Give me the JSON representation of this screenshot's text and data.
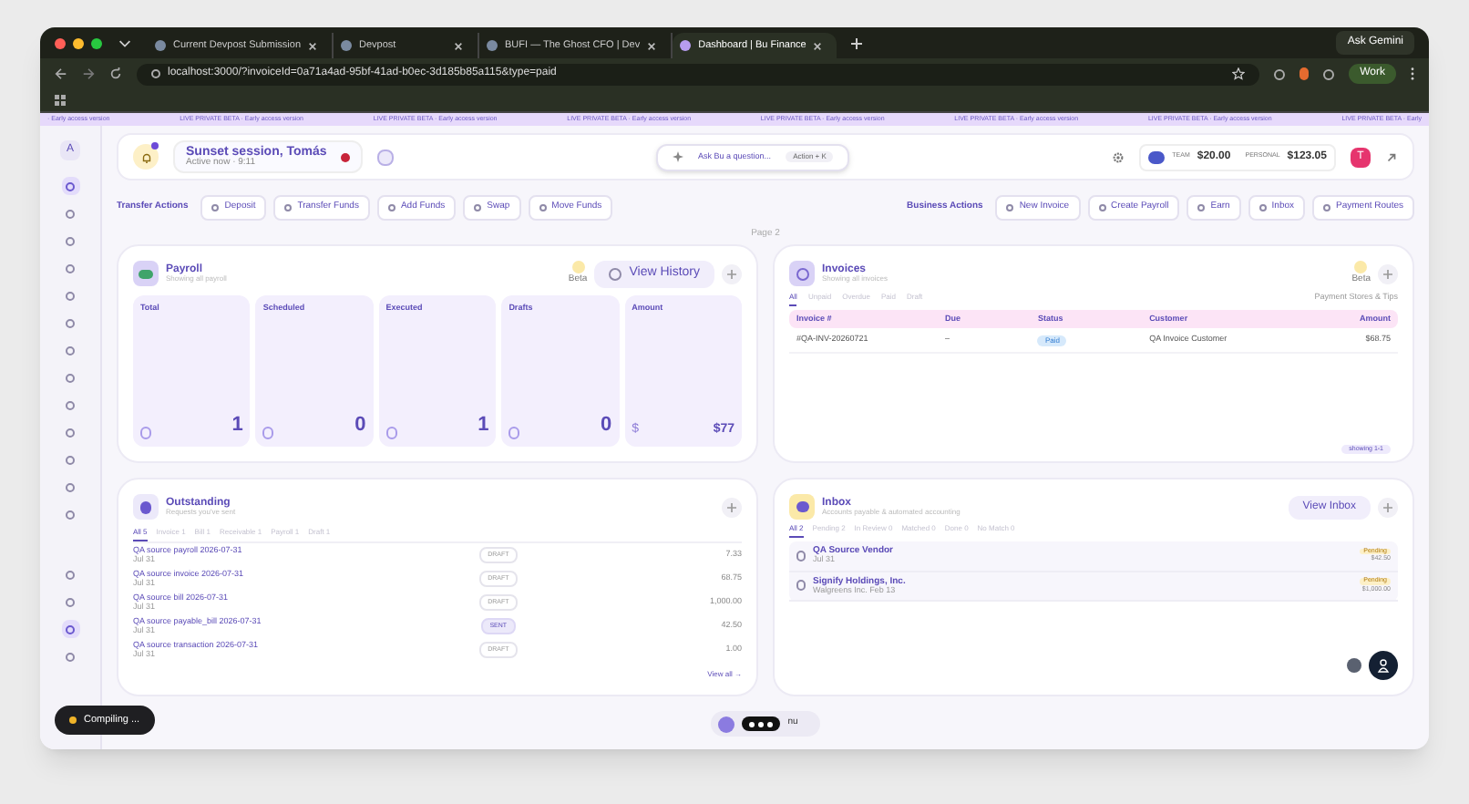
{
  "browser": {
    "tabs": [
      {
        "title": "Current Devpost Submission",
        "selected": false
      },
      {
        "title": "Devpost",
        "selected": false
      },
      {
        "title": "BUFI — The Ghost CFO | Dev",
        "selected": false
      },
      {
        "title": "Dashboard | Bu Finance",
        "selected": true
      }
    ],
    "ask_button": "Ask Gemini",
    "url": "localhost:3000/?invoiceId=0a71a4ad-95bf-41ad-b0ec-3d185b85a115&type=paid",
    "profile": "Work"
  },
  "banner": [
    "· Early access version",
    "LIVE PRIVATE BETA · Early access version",
    "LIVE PRIVATE BETA · Early access version",
    "LIVE PRIVATE BETA · Early access version",
    "LIVE PRIVATE BETA · Early access version",
    "LIVE PRIVATE BETA · Early access version",
    "LIVE PRIVATE BETA · Early access version",
    "LIVE PRIVATE BETA · Early"
  ],
  "sidebar": {
    "workspace": "A",
    "items": [
      {
        "selected": true
      },
      {
        "selected": false
      },
      {
        "selected": false
      },
      {
        "selected": false
      },
      {
        "selected": false
      },
      {
        "selected": false
      },
      {
        "selected": false
      },
      {
        "selected": false
      },
      {
        "selected": false
      },
      {
        "selected": false
      },
      {
        "selected": false
      },
      {
        "selected": false
      },
      {
        "selected": false
      }
    ],
    "bottom_items": [
      {
        "selected": false
      },
      {
        "selected": false
      },
      {
        "selected": true
      },
      {
        "selected": false
      }
    ]
  },
  "header": {
    "session": "Sunset session, Tomás",
    "session_sub": "Active now · 9:11",
    "ask": "Ask Bu a question...",
    "ask_shortcut": "Action + K",
    "team_label": "TEAM",
    "team_amount": "$20.00",
    "personal_label": "PERSONAL",
    "personal_amount": "$123.05",
    "avatar": "T"
  },
  "actions": {
    "transfer_label": "Transfer Actions",
    "transfer": [
      "Deposit",
      "Transfer Funds",
      "Add Funds",
      "Swap",
      "Move Funds"
    ],
    "business_label": "Business Actions",
    "business": [
      "New Invoice",
      "Create Payroll",
      "Earn",
      "Inbox",
      "Payment Routes"
    ]
  },
  "page_label": "Page 2",
  "payroll": {
    "title": "Payroll",
    "subtitle": "Showing all payroll",
    "beta": "Beta",
    "history_button": "View History",
    "stats": [
      {
        "label": "Total",
        "value": "1"
      },
      {
        "label": "Scheduled",
        "value": "0"
      },
      {
        "label": "Executed",
        "value": "1"
      },
      {
        "label": "Drafts",
        "value": "0"
      },
      {
        "label": "Amount",
        "value": "$77",
        "prefix": "$"
      }
    ]
  },
  "invoices": {
    "title": "Invoices",
    "subtitle": "Showing all invoices",
    "beta": "Beta",
    "tabs": [
      {
        "label": "All",
        "selected": true
      },
      {
        "label": "Unpaid",
        "selected": false
      },
      {
        "label": "Overdue",
        "selected": false
      },
      {
        "label": "Paid",
        "selected": false
      },
      {
        "label": "Draft",
        "selected": false
      }
    ],
    "right_link": "Payment Stores & Tips",
    "columns": [
      "Invoice #",
      "Due",
      "Status",
      "Customer",
      "Amount"
    ],
    "rows": [
      {
        "number": "#QA-INV-20260721",
        "due": "–",
        "status": "Paid",
        "customer": "QA Invoice Customer",
        "amount": "$68.75"
      }
    ],
    "showing": "showing 1-1"
  },
  "outstanding": {
    "title": "Outstanding",
    "subtitle": "Requests you've sent",
    "tabs": [
      {
        "label": "All 5",
        "selected": true
      },
      {
        "label": "Invoice 1",
        "selected": false
      },
      {
        "label": "Bill 1",
        "selected": false
      },
      {
        "label": "Receivable 1",
        "selected": false
      },
      {
        "label": "Payroll 1",
        "selected": false
      },
      {
        "label": "Draft 1",
        "selected": false
      }
    ],
    "rows": [
      {
        "title": "QA source payroll 2026-07-31",
        "sub": "Jul 31",
        "status": "DRAFT",
        "amount": "7.33"
      },
      {
        "title": "QA source invoice 2026-07-31",
        "sub": "Jul 31",
        "status": "DRAFT",
        "amount": "68.75"
      },
      {
        "title": "QA source bill 2026-07-31",
        "sub": "Jul 31",
        "status": "DRAFT",
        "amount": "1,000.00"
      },
      {
        "title": "QA source payable_bill 2026-07-31",
        "sub": "Jul 31",
        "status": "SENT",
        "amount": "42.50"
      },
      {
        "title": "QA source transaction 2026-07-31",
        "sub": "Jul 31",
        "status": "DRAFT",
        "amount": "1.00"
      }
    ],
    "view_all": "View all →"
  },
  "inbox": {
    "title": "Inbox",
    "subtitle": "Accounts payable & automated accounting",
    "button": "View Inbox",
    "tabs": [
      {
        "label": "All 2",
        "selected": true
      },
      {
        "label": "Pending 2",
        "selected": false
      },
      {
        "label": "In Review 0",
        "selected": false
      },
      {
        "label": "Matched 0",
        "selected": false
      },
      {
        "label": "Done 0",
        "selected": false
      },
      {
        "label": "No Match 0",
        "selected": false
      }
    ],
    "items": [
      {
        "vendor": "QA Source Vendor",
        "sub": "Jul 31",
        "status": "Pending",
        "amount": "$42.50"
      },
      {
        "vendor": "Signify Holdings, Inc.",
        "sub": "Walgreens Inc. Feb 13",
        "status": "Pending",
        "amount": "$1,000.00"
      }
    ]
  },
  "toast": "Compiling ...",
  "dock_label": "nu"
}
